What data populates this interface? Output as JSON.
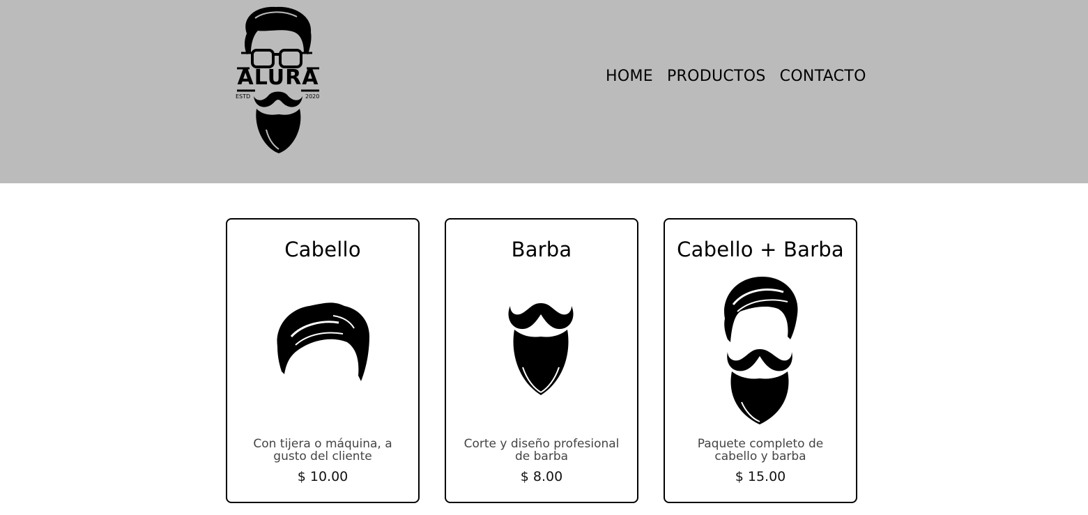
{
  "brand": {
    "logo_text": "ALURA",
    "logo_left": "ESTD",
    "logo_right": "2020"
  },
  "nav": {
    "home": "HOME",
    "products": "PRODUCTOS",
    "contact": "CONTACTO"
  },
  "products": [
    {
      "title": "Cabello",
      "description": "Con tijera o máquina, a gusto del cliente",
      "price": "$ 10.00",
      "icon": "hair-icon"
    },
    {
      "title": "Barba",
      "description": "Corte y diseño profesional de barba",
      "price": "$ 8.00",
      "icon": "beard-icon"
    },
    {
      "title": "Cabello + Barba",
      "description": "Paquete completo de cabello y barba",
      "price": "$ 15.00",
      "icon": "hair-and-beard-icon"
    }
  ]
}
